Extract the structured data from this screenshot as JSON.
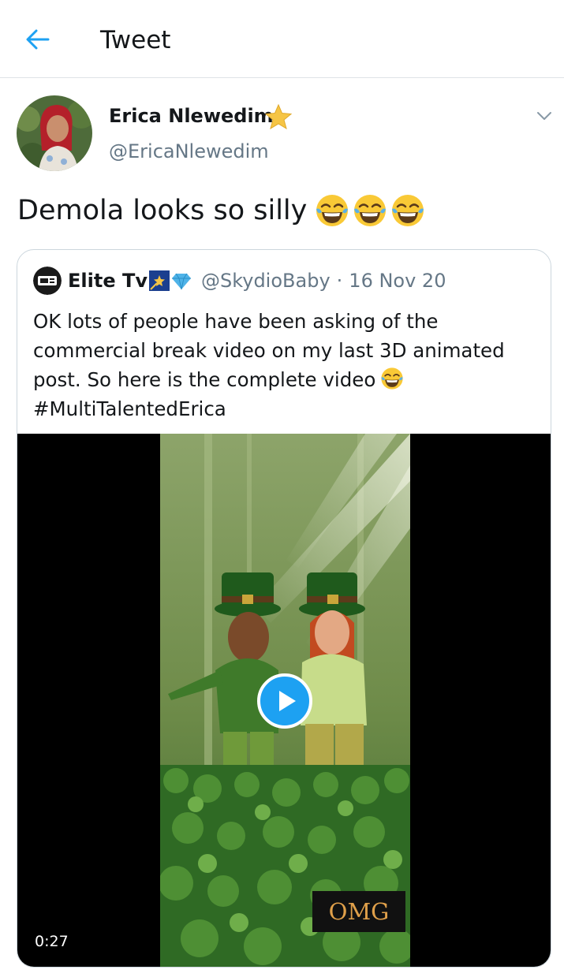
{
  "header": {
    "title": "Tweet",
    "back_icon": "arrow-left-icon"
  },
  "tweet": {
    "author_name": "Erica Nlewedim",
    "author_handle": "@EricaNlewedim",
    "text": "Demola looks so silly",
    "emojis": [
      "face-with-tears-of-joy",
      "face-with-tears-of-joy",
      "face-with-tears-of-joy"
    ]
  },
  "quoted_tweet": {
    "author_name": "Elite Tv",
    "author_handle": "@SkydioBaby",
    "separator": "·",
    "date": "16 Nov 20",
    "text": "OK lots of people have been asking of the commercial break video on my last 3D animated post. So here is the complete video",
    "hashtag": "#MultiTalentedErica",
    "video": {
      "duration": "0:27",
      "overlay_text": "OMG"
    }
  },
  "colors": {
    "accent": "#1da1f2",
    "secondary_text": "#657786",
    "border": "#ccd6dd"
  }
}
